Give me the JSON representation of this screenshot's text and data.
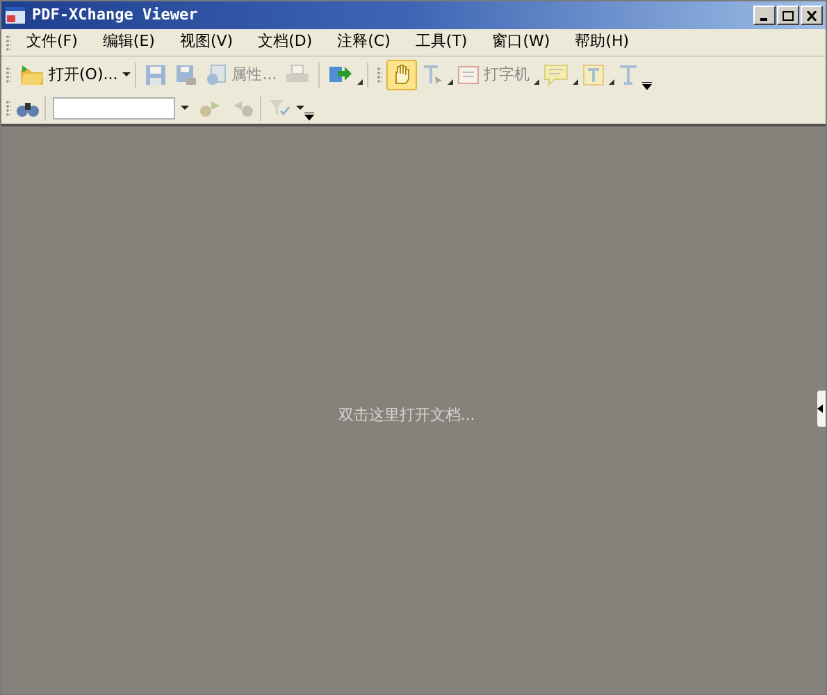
{
  "window": {
    "title": "PDF-XChange Viewer"
  },
  "menu": [
    {
      "label": "文件(F)"
    },
    {
      "label": "编辑(E)"
    },
    {
      "label": "视图(V)"
    },
    {
      "label": "文档(D)"
    },
    {
      "label": "注释(C)"
    },
    {
      "label": "工具(T)"
    },
    {
      "label": "窗口(W)"
    },
    {
      "label": "帮助(H)"
    }
  ],
  "toolbar": [
    {
      "kind": "open",
      "label": "打开(O)...",
      "disabled": false,
      "selected": false
    },
    {
      "kind": "save",
      "disabled": true,
      "selected": false
    },
    {
      "kind": "saveas",
      "disabled": true,
      "selected": false
    },
    {
      "kind": "properties",
      "label": "属性...",
      "disabled": true,
      "selected": false
    },
    {
      "kind": "print",
      "disabled": true,
      "selected": false
    },
    {
      "kind": "export",
      "disabled": false,
      "selected": false
    },
    {
      "kind": "hand",
      "disabled": false,
      "selected": true
    },
    {
      "kind": "select",
      "disabled": true,
      "selected": false
    },
    {
      "kind": "typewriter",
      "label": "打字机",
      "disabled": true,
      "selected": false
    },
    {
      "kind": "comment",
      "disabled": true,
      "selected": false
    },
    {
      "kind": "textbox",
      "disabled": true,
      "selected": false
    },
    {
      "kind": "text",
      "disabled": true,
      "selected": false
    }
  ],
  "search_toolbar": {
    "find_prev_disabled": true,
    "find_next_disabled": true
  },
  "document_area": {
    "hint": "双击这里打开文档..."
  }
}
